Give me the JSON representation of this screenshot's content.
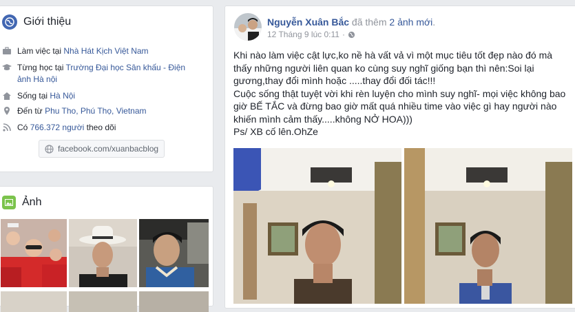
{
  "intro": {
    "title": "Giới thiệu",
    "work_prefix": "Làm việc tại",
    "work_link": "Nhà Hát Kịch Việt Nam",
    "study_prefix": "Từng học tại",
    "study_link_1": "Trường Đại học Sân khấu - Điện",
    "study_link_2": "ảnh Hà nội",
    "lives_prefix": "Sống tại",
    "lives_link": "Hà Nội",
    "from_prefix": "Đến từ",
    "from_link": "Phu Tho, Phú Thọ, Vietnam",
    "followers_prefix": "Có",
    "followers_count": "766.372 người",
    "followers_suffix": "theo dõi",
    "website": "facebook.com/xuanbacblog"
  },
  "photos": {
    "title": "Ảnh"
  },
  "post": {
    "author": "Nguyễn Xuân Bắc",
    "action_prefix": "đã thêm",
    "action_link": "2 ảnh mới",
    "action_suffix": ".",
    "timestamp": "12 Tháng 9 lúc 0:11",
    "separator": "·",
    "text_lines": [
      "Khi nào làm việc cật lực,ko nề hà vất vả vì một mục tiêu tốt đẹp nào đó mà",
      "thấy những người liên quan ko cùng suy nghĩ giống bạn thì nên:Soi lại",
      "gương,thay đổi mình hoặc .....thay đổi đối tác!!!",
      "Cuộc sống thật tuyệt vời khi rèn luyện cho mình suy nghĩ- mọi việc không bao",
      "giờ BẾ TẮC và đừng bao giờ mất quá nhiều time vào việc gì hay người nào",
      "khiến mình cảm thấy.....không NỞ HOA)))",
      "Ps/ XB cố lên.OhZe"
    ]
  },
  "colors": {
    "background": "#e9ebee",
    "link": "#365899",
    "muted": "#90949c",
    "intro_icon": "#4267b2",
    "photos_icon": "#7bc34c"
  },
  "icons": [
    "globe-icon",
    "briefcase-icon",
    "graduation-cap-icon",
    "home-icon",
    "location-pin-icon",
    "rss-icon",
    "photo-icon",
    "privacy-globe-icon"
  ]
}
